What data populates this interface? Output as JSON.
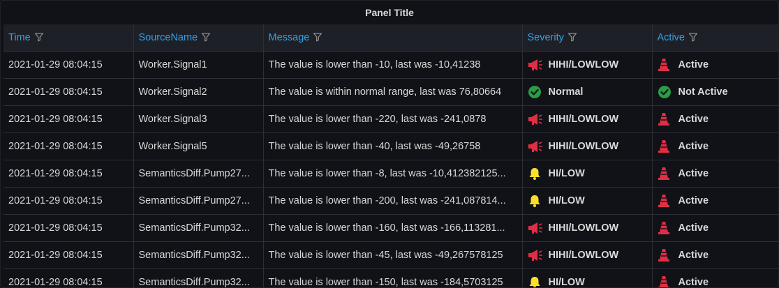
{
  "panel": {
    "title": "Panel Title"
  },
  "columns": [
    {
      "label": "Time"
    },
    {
      "label": "SourceName"
    },
    {
      "label": "Message"
    },
    {
      "label": "Severity"
    },
    {
      "label": "Active"
    }
  ],
  "colors": {
    "header_text": "#33a2e5",
    "danger": "#e02f44",
    "warning": "#fade2a",
    "ok": "#299c46"
  },
  "rows": [
    {
      "time": "2021-01-29 08:04:15",
      "source": "Worker.Signal1",
      "message": "The value is lower than -10, last was -10,41238",
      "severity": "HIHI/LOWLOW",
      "severity_icon": "megaphone-icon",
      "active": "Active",
      "active_icon": "cone-icon"
    },
    {
      "time": "2021-01-29 08:04:15",
      "source": "Worker.Signal2",
      "message": "The value is within normal range, last was 76,80664",
      "severity": "Normal",
      "severity_icon": "check-circle-icon",
      "active": "Not Active",
      "active_icon": "check-circle-icon"
    },
    {
      "time": "2021-01-29 08:04:15",
      "source": "Worker.Signal3",
      "message": "The value is lower than -220, last was -241,0878",
      "severity": "HIHI/LOWLOW",
      "severity_icon": "megaphone-icon",
      "active": "Active",
      "active_icon": "cone-icon"
    },
    {
      "time": "2021-01-29 08:04:15",
      "source": "Worker.Signal5",
      "message": "The value is lower than -40, last was -49,26758",
      "severity": "HIHI/LOWLOW",
      "severity_icon": "megaphone-icon",
      "active": "Active",
      "active_icon": "cone-icon"
    },
    {
      "time": "2021-01-29 08:04:15",
      "source": "SemanticsDiff.Pump27...",
      "message": "The value is lower than -8, last was -10,412382125...",
      "severity": "HI/LOW",
      "severity_icon": "bell-icon",
      "active": "Active",
      "active_icon": "cone-icon"
    },
    {
      "time": "2021-01-29 08:04:15",
      "source": "SemanticsDiff.Pump27...",
      "message": "The value is lower than -200, last was -241,087814...",
      "severity": "HI/LOW",
      "severity_icon": "bell-icon",
      "active": "Active",
      "active_icon": "cone-icon"
    },
    {
      "time": "2021-01-29 08:04:15",
      "source": "SemanticsDiff.Pump32...",
      "message": "The value is lower than -160, last was -166,113281...",
      "severity": "HIHI/LOWLOW",
      "severity_icon": "megaphone-icon",
      "active": "Active",
      "active_icon": "cone-icon"
    },
    {
      "time": "2021-01-29 08:04:15",
      "source": "SemanticsDiff.Pump32...",
      "message": "The value is lower than -45, last was -49,267578125",
      "severity": "HIHI/LOWLOW",
      "severity_icon": "megaphone-icon",
      "active": "Active",
      "active_icon": "cone-icon"
    },
    {
      "time": "2021-01-29 08:04:15",
      "source": "SemanticsDiff.Pump32...",
      "message": "The value is lower than -150, last was -184,5703125",
      "severity": "HI/LOW",
      "severity_icon": "bell-icon",
      "active": "Active",
      "active_icon": "cone-icon"
    }
  ]
}
